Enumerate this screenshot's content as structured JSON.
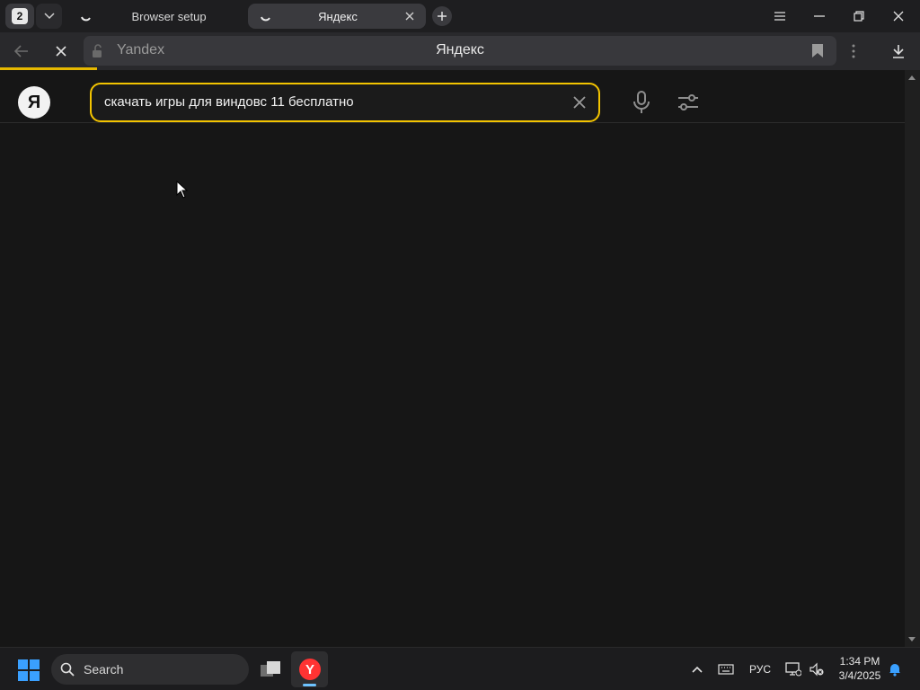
{
  "browser": {
    "tab_count": "2",
    "tabs": [
      {
        "label": "Browser setup",
        "active": false
      },
      {
        "label": "Яндекс",
        "active": true
      }
    ]
  },
  "address_bar": {
    "host": "Yandex",
    "page_title": "Яндекс"
  },
  "page": {
    "logo_letter": "Я",
    "search_query": "скачать игры для виндовс 11 бесплатно"
  },
  "taskbar": {
    "search_label": "Search",
    "language": "РУС",
    "time": "1:34 PM",
    "date": "3/4/2025"
  },
  "colors": {
    "accent_yellow": "#f3c400",
    "windows_blue": "#3aa0ff",
    "yandex_red": "#ff3333"
  }
}
